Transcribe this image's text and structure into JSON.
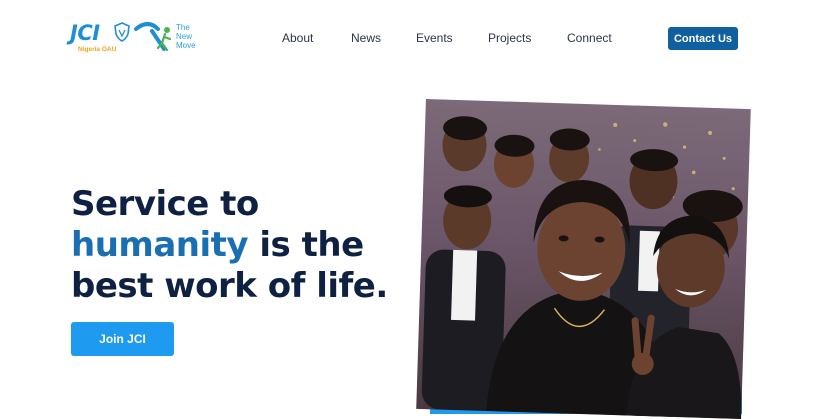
{
  "logo": {
    "brand": "JCI",
    "chapter": "Nigeria OAU",
    "tagline_lines": [
      "The",
      "New",
      "Move"
    ]
  },
  "nav": {
    "items": [
      {
        "label": "About"
      },
      {
        "label": "News"
      },
      {
        "label": "Events"
      },
      {
        "label": "Projects"
      },
      {
        "label": "Connect"
      }
    ],
    "cta": "Contact Us"
  },
  "hero": {
    "line1": "Service to",
    "accent": "humanity",
    "line2_rest": " is the",
    "line3": "best work of life.",
    "button": "Join JCI"
  },
  "colors": {
    "brand_blue": "#1e8fd6",
    "navy_text": "#0f2142",
    "accent_blue": "#1a6fb3",
    "contact_bg": "#10609f",
    "join_bg": "#1e9bf0",
    "logo_gold": "#f4a31c"
  },
  "photo": {
    "subject": "group-selfie-image"
  }
}
